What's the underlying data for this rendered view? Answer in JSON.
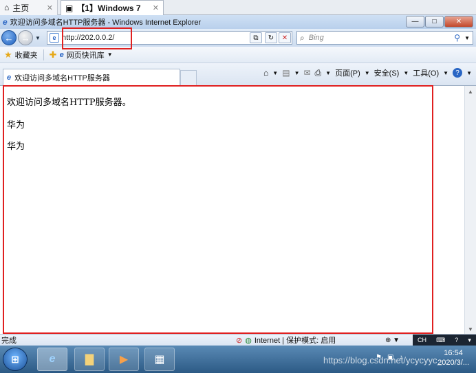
{
  "host_tabs": [
    {
      "label": "主页",
      "icon": "home-icon"
    },
    {
      "label": "【1】Windows 7",
      "icon": "vm-icon"
    }
  ],
  "window": {
    "title": "欢迎访问多域名HTTP服务器 - Windows Internet Explorer",
    "min": "—",
    "max": "□",
    "close": "✕"
  },
  "nav": {
    "address": "http://202.0.0.2/",
    "search_placeholder": "Bing"
  },
  "favorites": {
    "label": "收藏夹",
    "items": [
      {
        "label": "网页快讯库"
      }
    ]
  },
  "tab": {
    "title": "欢迎访问多域名HTTP服务器"
  },
  "commands": {
    "page": "页面(P)",
    "safety": "安全(S)",
    "tools": "工具(O)"
  },
  "page_content": {
    "lines": [
      "欢迎访问多域名HTTP服务器。",
      "华为",
      "华为"
    ]
  },
  "status": {
    "done": "完成",
    "zone": "Internet | 保护模式: 启用",
    "ime": "CH"
  },
  "taskbar": {
    "time": "16:54",
    "date": "2020/3/...",
    "watermark": "https://blog.csdn.net/ycycyyc_"
  },
  "colors": {
    "annotation": "#e02020",
    "accent": "#1d5fbf"
  }
}
